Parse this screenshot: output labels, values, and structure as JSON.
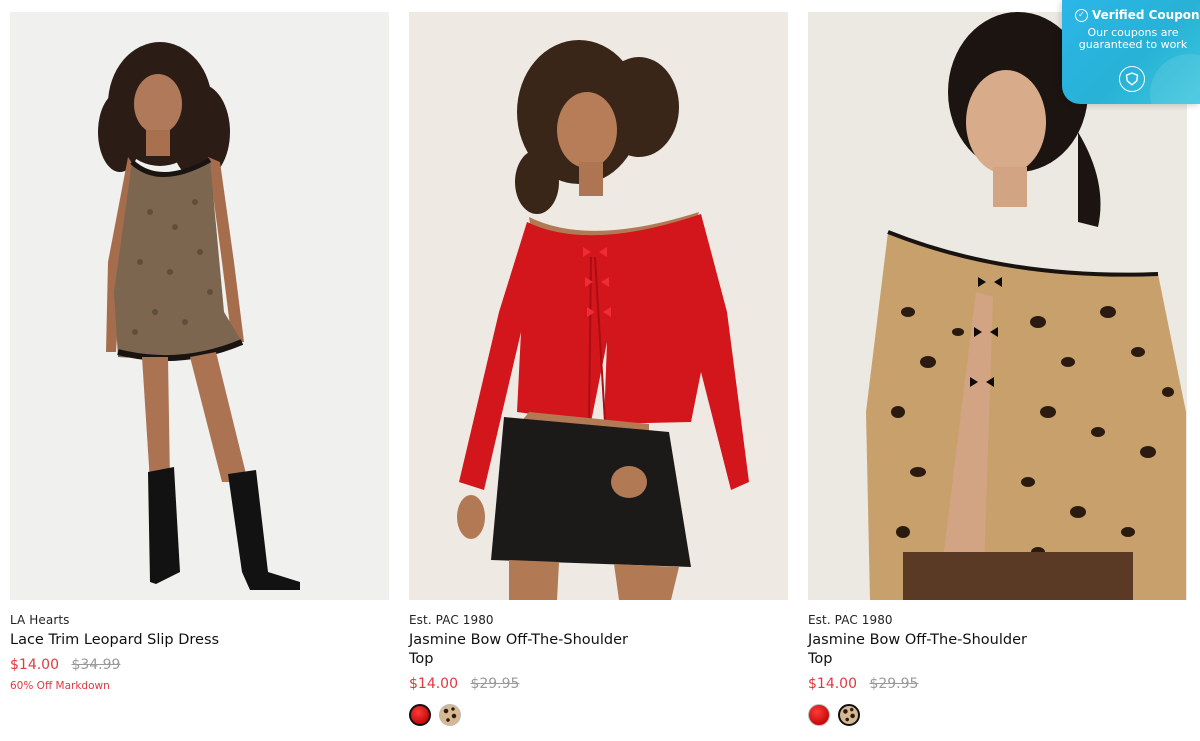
{
  "products": [
    {
      "brand": "LA Hearts",
      "title": "Lace Trim Leopard Slip Dress",
      "price_sale": "$14.00",
      "price_original": "$34.99",
      "markdown": "60% Off Markdown",
      "photo": "woman-in-leopard-slip-dress-photo"
    },
    {
      "brand": "Est. PAC 1980",
      "title": "Jasmine Bow Off-The-Shoulder Top",
      "price_sale": "$14.00",
      "price_original": "$29.95",
      "photo": "woman-in-red-bow-top-photo",
      "swatches": [
        "red",
        "leopard"
      ],
      "selected_swatch": "red"
    },
    {
      "brand": "Est. PAC 1980",
      "title": "Jasmine Bow Off-The-Shoulder Top",
      "price_sale": "$14.00",
      "price_original": "$29.95",
      "photo": "woman-in-leopard-bow-top-photo",
      "swatches": [
        "red",
        "leopard"
      ],
      "selected_swatch": "leopard"
    }
  ],
  "coupon": {
    "title": "Verified Coupon",
    "subtitle": "Our coupons are guaranteed to work",
    "icon": "shield-icon"
  },
  "colors": {
    "sale": "#e0393e",
    "original": "#9a9a9a",
    "coupon_bg": "#2bb6e8"
  }
}
